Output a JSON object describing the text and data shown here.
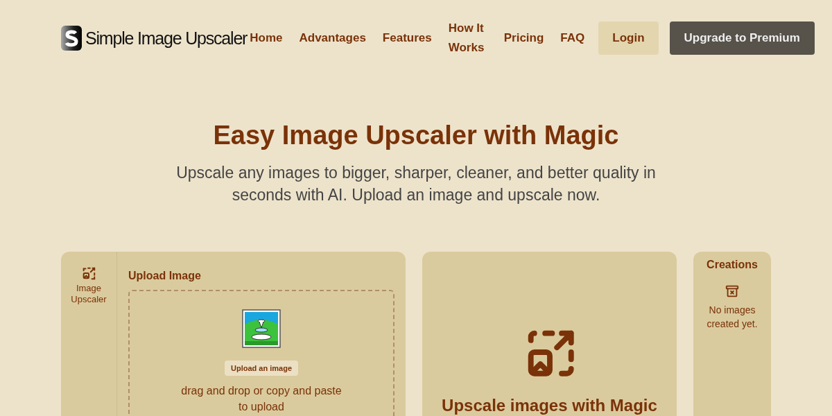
{
  "header": {
    "logo_text": "Simple Image Upscaler",
    "nav": [
      "Home",
      "Advantages",
      "Features",
      "How It Works",
      "Pricing",
      "FAQ"
    ],
    "login": "Login",
    "upgrade": "Upgrade to Premium"
  },
  "hero": {
    "title": "Easy Image Upscaler with Magic",
    "subtitle": "Upscale any images to bigger, sharper, cleaner, and better quality in seconds with AI. Upload an image and upscale now."
  },
  "tool_nav": {
    "label": "Image Upscaler"
  },
  "upload": {
    "heading": "Upload Image",
    "button": "Upload an image",
    "hint": "drag and drop or copy and paste to upload"
  },
  "result": {
    "heading": "Upscale images with Magic"
  },
  "creations": {
    "heading": "Creations",
    "empty": "No images created yet."
  }
}
